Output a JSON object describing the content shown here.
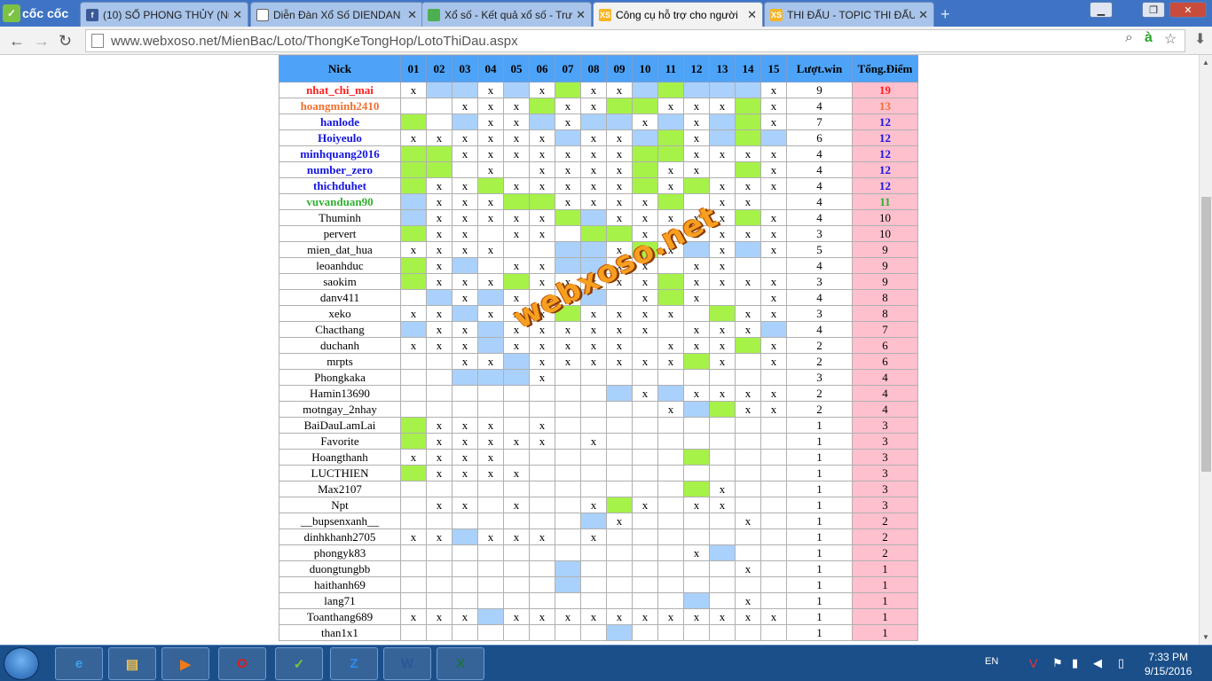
{
  "browser": {
    "brand": "cốc cốc",
    "tabs": [
      {
        "label": "(10) SỐ PHONG THỦY (Nu",
        "icon": "facebook-icon",
        "color": "#3b5998",
        "glyph": "f"
      },
      {
        "label": "Diễn Đàn Xổ Số DIENDAN",
        "icon": "page-icon",
        "color": "#ffffff",
        "glyph": ""
      },
      {
        "label": "Xổ số - Kết quả xổ số - Trư",
        "icon": "chrome-icon",
        "color": "#4caf50",
        "glyph": ""
      },
      {
        "label": "Công cụ hỗ trợ cho người",
        "icon": "xs-icon",
        "color": "#f5b525",
        "glyph": "XS"
      },
      {
        "label": "THI ĐẤU - TOPIC THI ĐẤU",
        "icon": "xs-icon",
        "color": "#f5b525",
        "glyph": "XS"
      }
    ],
    "url": "www.webxoso.net/MienBac/Loto/ThongKeTongHop/LotoThiDau.aspx"
  },
  "table": {
    "headers": [
      "Nick",
      "01",
      "02",
      "03",
      "04",
      "05",
      "06",
      "07",
      "08",
      "09",
      "10",
      "11",
      "12",
      "13",
      "14",
      "15",
      "Lượt.win",
      "Tổng.Điểm"
    ],
    "rows": [
      {
        "nick": "nhat_chi_mai",
        "style": "n-red",
        "cells": [
          "x",
          "b",
          "b",
          "x",
          "b",
          "x",
          "g",
          "x",
          "x",
          "b",
          "g",
          "b",
          "b",
          "b",
          "x"
        ],
        "win": "9",
        "total": "19"
      },
      {
        "nick": "hoangminh2410",
        "style": "n-org",
        "cells": [
          "",
          "",
          "x",
          "x",
          "x",
          "g",
          "x",
          "x",
          "g",
          "g",
          "x",
          "x",
          "x",
          "g",
          "x"
        ],
        "win": "4",
        "total": "13"
      },
      {
        "nick": "hanlode",
        "style": "n-blu",
        "cells": [
          "g",
          "",
          "b",
          "x",
          "x",
          "b",
          "x",
          "b",
          "b",
          "x",
          "b",
          "x",
          "b",
          "g",
          "x"
        ],
        "win": "7",
        "total": "12"
      },
      {
        "nick": "Hoiyeulo",
        "style": "n-blu",
        "cells": [
          "x",
          "x",
          "x",
          "x",
          "x",
          "x",
          "b",
          "x",
          "x",
          "b",
          "g",
          "x",
          "b",
          "g",
          "b"
        ],
        "win": "6",
        "total": "12"
      },
      {
        "nick": "minhquang2016",
        "style": "n-blu",
        "cells": [
          "g",
          "g",
          "x",
          "x",
          "x",
          "x",
          "x",
          "x",
          "x",
          "g",
          "g",
          "x",
          "x",
          "x",
          "x"
        ],
        "win": "4",
        "total": "12"
      },
      {
        "nick": "number_zero",
        "style": "n-blu",
        "cells": [
          "g",
          "g",
          "",
          "x",
          "",
          "x",
          "x",
          "x",
          "x",
          "g",
          "x",
          "x",
          "",
          "g",
          "x"
        ],
        "win": "4",
        "total": "12"
      },
      {
        "nick": "thichduhet",
        "style": "n-blu",
        "cells": [
          "g",
          "x",
          "x",
          "g",
          "x",
          "x",
          "x",
          "x",
          "x",
          "g",
          "x",
          "g",
          "x",
          "x",
          "x"
        ],
        "win": "4",
        "total": "12"
      },
      {
        "nick": "vuvanduan90",
        "style": "n-grn",
        "cells": [
          "b",
          "x",
          "x",
          "x",
          "g",
          "g",
          "x",
          "x",
          "x",
          "x",
          "g",
          "",
          "x",
          "x",
          ""
        ],
        "win": "4",
        "total": "11"
      },
      {
        "nick": "Thuminh",
        "style": "",
        "cells": [
          "b",
          "x",
          "x",
          "x",
          "x",
          "x",
          "g",
          "b",
          "x",
          "x",
          "x",
          "x",
          "x",
          "g",
          "x"
        ],
        "win": "4",
        "total": "10"
      },
      {
        "nick": "pervert",
        "style": "",
        "cells": [
          "g",
          "x",
          "x",
          "",
          "x",
          "x",
          "",
          "g",
          "g",
          "x",
          "x",
          "x",
          "x",
          "x",
          "x"
        ],
        "win": "3",
        "total": "10"
      },
      {
        "nick": "mien_dat_hua",
        "style": "",
        "cells": [
          "x",
          "x",
          "x",
          "x",
          "",
          "",
          "b",
          "b",
          "x",
          "g",
          "x",
          "b",
          "x",
          "b",
          "x"
        ],
        "win": "5",
        "total": "9"
      },
      {
        "nick": "leoanhduc",
        "style": "",
        "cells": [
          "g",
          "x",
          "b",
          "",
          "x",
          "x",
          "b",
          "b",
          "x",
          "x",
          "",
          "x",
          "x",
          "",
          ""
        ],
        "win": "4",
        "total": "9"
      },
      {
        "nick": "saokim",
        "style": "",
        "cells": [
          "g",
          "x",
          "x",
          "x",
          "g",
          "x",
          "x",
          "x",
          "x",
          "x",
          "g",
          "x",
          "x",
          "x",
          "x"
        ],
        "win": "3",
        "total": "9"
      },
      {
        "nick": "danv411",
        "style": "",
        "cells": [
          "",
          "b",
          "x",
          "b",
          "x",
          "",
          "x",
          "b",
          "",
          "x",
          "g",
          "x",
          "",
          "",
          "x"
        ],
        "win": "4",
        "total": "8"
      },
      {
        "nick": "xeko",
        "style": "",
        "cells": [
          "x",
          "x",
          "b",
          "x",
          "x",
          "x",
          "g",
          "x",
          "x",
          "x",
          "x",
          "",
          "g",
          "x",
          "x"
        ],
        "win": "3",
        "total": "8"
      },
      {
        "nick": "Chacthang",
        "style": "",
        "cells": [
          "b",
          "x",
          "x",
          "b",
          "x",
          "x",
          "x",
          "x",
          "x",
          "x",
          "",
          "x",
          "x",
          "x",
          "b"
        ],
        "win": "4",
        "total": "7"
      },
      {
        "nick": "duchanh",
        "style": "",
        "cells": [
          "x",
          "x",
          "x",
          "b",
          "x",
          "x",
          "x",
          "x",
          "x",
          "",
          "x",
          "x",
          "x",
          "g",
          "x"
        ],
        "win": "2",
        "total": "6"
      },
      {
        "nick": "mrpts",
        "style": "",
        "cells": [
          "",
          "",
          "x",
          "x",
          "b",
          "x",
          "x",
          "x",
          "x",
          "x",
          "x",
          "g",
          "x",
          "",
          "x"
        ],
        "win": "2",
        "total": "6"
      },
      {
        "nick": "Phongkaka",
        "style": "",
        "cells": [
          "",
          "",
          "b",
          "b",
          "b",
          "x",
          "",
          "",
          "",
          "",
          "",
          "",
          "",
          "",
          ""
        ],
        "win": "3",
        "total": "4"
      },
      {
        "nick": "Hamin13690",
        "style": "",
        "cells": [
          "",
          "",
          "",
          "",
          "",
          "",
          "",
          "",
          "b",
          "x",
          "b",
          "x",
          "x",
          "x",
          "x"
        ],
        "win": "2",
        "total": "4"
      },
      {
        "nick": "motngay_2nhay",
        "style": "",
        "cells": [
          "",
          "",
          "",
          "",
          "",
          "",
          "",
          "",
          "",
          "",
          "x",
          "b",
          "g",
          "x",
          "x"
        ],
        "win": "2",
        "total": "4"
      },
      {
        "nick": "BaiDauLamLai",
        "style": "",
        "cells": [
          "g",
          "x",
          "x",
          "x",
          "",
          "x",
          "",
          "",
          "",
          "",
          "",
          "",
          "",
          "",
          ""
        ],
        "win": "1",
        "total": "3"
      },
      {
        "nick": "Favorite",
        "style": "",
        "cells": [
          "g",
          "x",
          "x",
          "x",
          "x",
          "x",
          "",
          "x",
          "",
          "",
          "",
          "",
          "",
          "",
          ""
        ],
        "win": "1",
        "total": "3"
      },
      {
        "nick": "Hoangthanh",
        "style": "",
        "cells": [
          "x",
          "x",
          "x",
          "x",
          "",
          "",
          "",
          "",
          "",
          "",
          "",
          "g",
          "",
          "",
          ""
        ],
        "win": "1",
        "total": "3"
      },
      {
        "nick": "LUCTHIEN",
        "style": "",
        "cells": [
          "g",
          "x",
          "x",
          "x",
          "x",
          "",
          "",
          "",
          "",
          "",
          "",
          "",
          "",
          "",
          ""
        ],
        "win": "1",
        "total": "3"
      },
      {
        "nick": "Max2107",
        "style": "",
        "cells": [
          "",
          "",
          "",
          "",
          "",
          "",
          "",
          "",
          "",
          "",
          "",
          "g",
          "x",
          "",
          ""
        ],
        "win": "1",
        "total": "3"
      },
      {
        "nick": "Npt",
        "style": "",
        "cells": [
          "",
          "x",
          "x",
          "",
          "x",
          "",
          "",
          "x",
          "g",
          "x",
          "",
          "x",
          "x",
          "",
          ""
        ],
        "win": "1",
        "total": "3"
      },
      {
        "nick": "__bupsenxanh__",
        "style": "",
        "cells": [
          "",
          "",
          "",
          "",
          "",
          "",
          "",
          "b",
          "x",
          "",
          "",
          "",
          "",
          "x",
          ""
        ],
        "win": "1",
        "total": "2"
      },
      {
        "nick": "dinhkhanh2705",
        "style": "",
        "cells": [
          "x",
          "x",
          "b",
          "x",
          "x",
          "x",
          "",
          "x",
          "",
          "",
          "",
          "",
          "",
          "",
          ""
        ],
        "win": "1",
        "total": "2"
      },
      {
        "nick": "phongyk83",
        "style": "",
        "cells": [
          "",
          "",
          "",
          "",
          "",
          "",
          "",
          "",
          "",
          "",
          "",
          "x",
          "b",
          "",
          ""
        ],
        "win": "1",
        "total": "2"
      },
      {
        "nick": "duongtungbb",
        "style": "",
        "cells": [
          "",
          "",
          "",
          "",
          "",
          "",
          "b",
          "",
          "",
          "",
          "",
          "",
          "",
          "x",
          ""
        ],
        "win": "1",
        "total": "1"
      },
      {
        "nick": "haithanh69",
        "style": "",
        "cells": [
          "",
          "",
          "",
          "",
          "",
          "",
          "b",
          "",
          "",
          "",
          "",
          "",
          "",
          "",
          ""
        ],
        "win": "1",
        "total": "1"
      },
      {
        "nick": "lang71",
        "style": "",
        "cells": [
          "",
          "",
          "",
          "",
          "",
          "",
          "",
          "",
          "",
          "",
          "",
          "b",
          "",
          "x",
          ""
        ],
        "win": "1",
        "total": "1"
      },
      {
        "nick": "Toanthang689",
        "style": "",
        "cells": [
          "x",
          "x",
          "x",
          "b",
          "x",
          "x",
          "x",
          "x",
          "x",
          "x",
          "x",
          "x",
          "x",
          "x",
          "x"
        ],
        "win": "1",
        "total": "1"
      },
      {
        "nick": "than1x1",
        "style": "",
        "cells": [
          "",
          "",
          "",
          "",
          "",
          "",
          "",
          "",
          "b",
          "",
          "",
          "",
          "",
          "",
          ""
        ],
        "win": "1",
        "total": "1"
      }
    ]
  },
  "watermark": "webxoso.net",
  "taskbar": {
    "lang": "EN",
    "time": "7:33 PM",
    "date": "9/15/2016"
  },
  "colors": {
    "header": "#4da3f7",
    "green": "#a6f249",
    "blue": "#a9d1fb",
    "pink": "#ffc0ce"
  }
}
